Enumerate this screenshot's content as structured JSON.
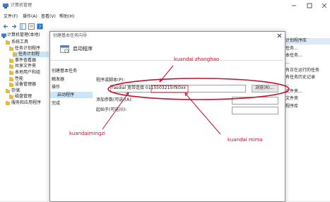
{
  "window": {
    "title": "计算机管理"
  },
  "menu": [
    "文件(F)",
    "操作(A)",
    "查看(V)",
    "帮助(H)"
  ],
  "tree": {
    "root": "计算机管理(本地)",
    "items": [
      {
        "label": "系统工具",
        "indent": 1
      },
      {
        "label": "任务计划程序",
        "indent": 2
      },
      {
        "label": "任务计划程",
        "indent": 3
      },
      {
        "label": "事件查看器",
        "indent": 2
      },
      {
        "label": "共享文件夹",
        "indent": 2
      },
      {
        "label": "本地用户和组",
        "indent": 2
      },
      {
        "label": "性能",
        "indent": 2
      },
      {
        "label": "设备管理器",
        "indent": 2
      },
      {
        "label": "存储",
        "indent": 1
      },
      {
        "label": "磁盘管理",
        "indent": 2
      },
      {
        "label": "服务和应用程序",
        "indent": 1
      }
    ]
  },
  "right_pane": {
    "header": "计划程序库",
    "items": [
      "任务...",
      "本任务...",
      "...",
      "有正在运行的任务",
      "有任务历史记录",
      "...",
      "文件夹...",
      "文件夹",
      "程序库",
      "",
      "",
      "",
      "",
      "",
      "",
      ""
    ]
  },
  "wizard": {
    "title": "创建基本任务向导",
    "header_title": "启动程序",
    "steps": [
      "创建基本任务",
      "触发器",
      "操作",
      "启动程序",
      "完成"
    ],
    "selected_step": "启动程序",
    "program_label": "程序或脚本(P):",
    "program_value": "rasdial 宽带连接 0115503215rfk0xx",
    "browse_label": "浏览(R)...",
    "args_label": "添加参数(可选)(A):",
    "start_label": "起始于(可选)(I):"
  },
  "annotations": {
    "zhanghao": "kuandai zhanghao",
    "mingzi": "kuandaimingzi",
    "mima": "kuandai mima"
  },
  "colors": {
    "annotation": "#c8102e",
    "selected_step": "#cce4f7"
  }
}
